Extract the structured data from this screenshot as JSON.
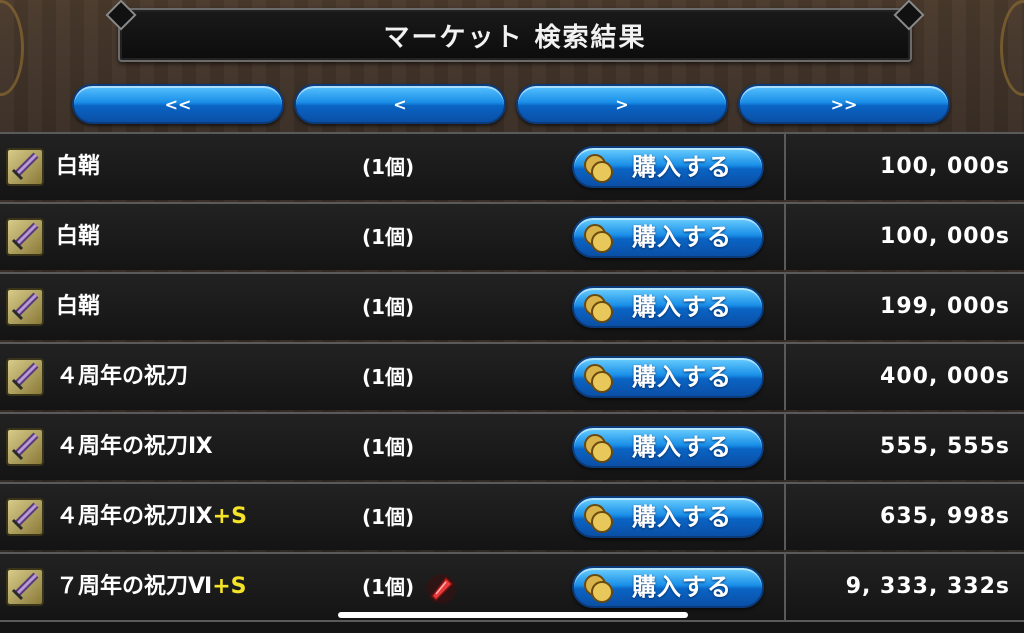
{
  "header": {
    "title": "マーケット 検索結果"
  },
  "nav": {
    "first": "<<",
    "prev": "<",
    "next": ">",
    "last": ">>"
  },
  "buy_label": "購入する",
  "colors": {
    "button_blue": "#1a8fe8",
    "plus_yellow": "#f5e32a",
    "row_border": "#5a5a5a"
  },
  "items": [
    {
      "name": "白鞘",
      "suffix": "",
      "qty": "(1個)",
      "price": "100, 000s",
      "icon": "sword-icon",
      "badge": ""
    },
    {
      "name": "白鞘",
      "suffix": "",
      "qty": "(1個)",
      "price": "100, 000s",
      "icon": "sword-icon",
      "badge": ""
    },
    {
      "name": "白鞘",
      "suffix": "",
      "qty": "(1個)",
      "price": "199, 000s",
      "icon": "sword-icon",
      "badge": ""
    },
    {
      "name": "４周年の祝刀",
      "suffix": "",
      "qty": "(1個)",
      "price": "400, 000s",
      "icon": "sword-icon",
      "badge": ""
    },
    {
      "name": "４周年の祝刀Ⅸ",
      "suffix": "",
      "qty": "(1個)",
      "price": "555, 555s",
      "icon": "sword-icon",
      "badge": ""
    },
    {
      "name": "４周年の祝刀Ⅸ",
      "suffix": "+S",
      "qty": "(1個)",
      "price": "635, 998s",
      "icon": "sword-icon",
      "badge": ""
    },
    {
      "name": "７周年の祝刀Ⅵ",
      "suffix": "+S",
      "qty": "(1個)",
      "price": "9, 333, 332s",
      "icon": "sword-icon",
      "badge": "red-gem-icon"
    }
  ]
}
